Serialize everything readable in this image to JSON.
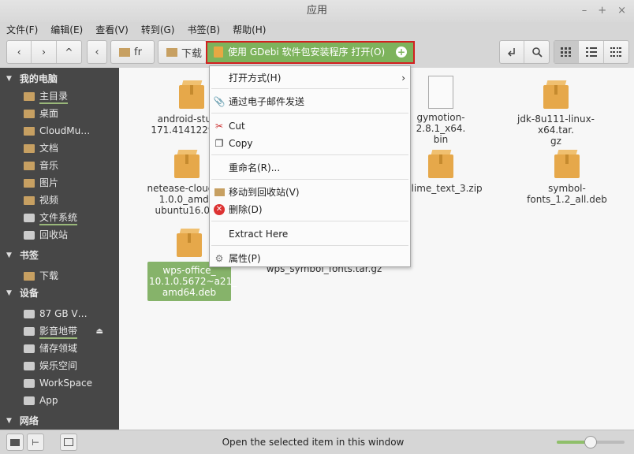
{
  "window": {
    "title": "应用",
    "controls": [
      "–",
      "+",
      "×"
    ]
  },
  "menubar": [
    "文件(F)",
    "编辑(E)",
    "查看(V)",
    "转到(G)",
    "书签(B)",
    "帮助(H)"
  ],
  "toolbar": {
    "back": "‹",
    "forward": "›",
    "up": "^",
    "prev_crumb": "‹",
    "crumbs": [
      {
        "label": "fr"
      },
      {
        "label": "下载"
      }
    ],
    "view_icons": [
      "grid-view-icon",
      "list-view-icon",
      "compact-view-icon"
    ]
  },
  "sidebar": {
    "sections": [
      {
        "title": "我的电脑",
        "items": [
          "主目录",
          "桌面",
          "CloudMu…",
          "文档",
          "音乐",
          "图片",
          "视频",
          "文件系统",
          "回收站"
        ]
      },
      {
        "title": "书签",
        "items": [
          "下载"
        ]
      },
      {
        "title": "设备",
        "items": [
          "87 GB V…",
          "影音地带",
          "储存领域",
          "娱乐空间",
          "WorkSpace",
          "App"
        ]
      },
      {
        "title": "网络",
        "items": []
      }
    ]
  },
  "files": [
    {
      "name": "android-studio-ide-171.4141229-linux.zip",
      "label": "android-studio\n171.4141229-li…",
      "type": "package"
    },
    {
      "name": "gymotion-2.8.1_x64.bin",
      "label": "gymotion-2.8.1_x64.\nbin",
      "type": "document"
    },
    {
      "name": "jdk-8u111-linux-x64.tar.gz",
      "label": "jdk-8u111-linux-x64.tar.\ngz",
      "type": "package"
    },
    {
      "name": "netease-cloud-music_1.0.0_amd64_ubuntu16.04.deb",
      "label": "netease-cloud-m\n1.0.0_amd6\nubuntu16.04.",
      "type": "package"
    },
    {
      "name": "sublime_text_3.zip",
      "label": "ublime_text_3.zip",
      "type": "package"
    },
    {
      "name": "symbol-fonts_1.2_all.deb",
      "label": "symbol-fonts_1.2_all.deb",
      "type": "package"
    },
    {
      "name": "wps-office_10.1.0.5672~a21_amd64.deb",
      "label": "wps-office_\n10.1.0.5672~a21_\namd64.deb",
      "type": "package",
      "selected": true
    },
    {
      "name": "wps_symbol_fonts.tar.gz",
      "label": "wps_symbol_fonts.tar.gz",
      "type": "package"
    }
  ],
  "context_menu": {
    "highlighted": "使用 GDebi 软件包安装程序 打开(O)",
    "items": [
      {
        "label": "打开方式(H)",
        "icon": "",
        "submenu": "›"
      },
      {
        "label": "通过电子邮件发送",
        "icon": "paperclip-icon"
      },
      {
        "label": "Cut",
        "icon": "scissors-icon"
      },
      {
        "label": "Copy",
        "icon": "copy-icon"
      },
      {
        "label": "重命名(R)...",
        "icon": ""
      },
      {
        "label": "移动到回收站(V)",
        "icon": "folder-trash-icon"
      },
      {
        "label": "删除(D)",
        "icon": "delete-icon"
      },
      {
        "label": "Extract Here",
        "icon": ""
      },
      {
        "label": "属性(P)",
        "icon": "properties-icon"
      }
    ]
  },
  "statusbar": {
    "text": "Open the selected item in this window",
    "zoom": 0.5
  }
}
